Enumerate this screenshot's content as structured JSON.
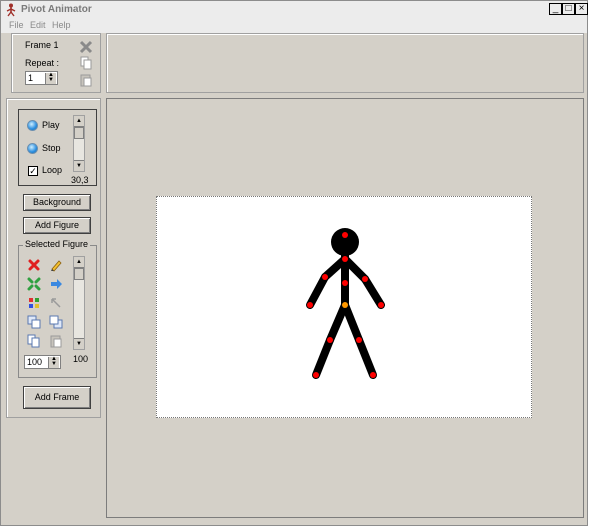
{
  "window": {
    "title": "Pivot Animator",
    "min": "_",
    "max": "□",
    "close": "×"
  },
  "menu": [
    "File",
    "Edit",
    "Help"
  ],
  "frame": {
    "label": "Frame 1",
    "repeat_label": "Repeat :",
    "repeat_value": "1"
  },
  "playback": {
    "play": "Play",
    "stop": "Stop",
    "loop": "Loop",
    "loop_checked": "✓",
    "speed": "30,3"
  },
  "buttons": {
    "background": "Background",
    "add_figure": "Add Figure",
    "add_frame": "Add Frame"
  },
  "selected_figure": {
    "title": "Selected Figure",
    "size_value": "100",
    "size_readout": "100"
  },
  "figure": {
    "color": "#000000",
    "joint_color": "#ff0000",
    "origin_color": "#ff9900"
  }
}
